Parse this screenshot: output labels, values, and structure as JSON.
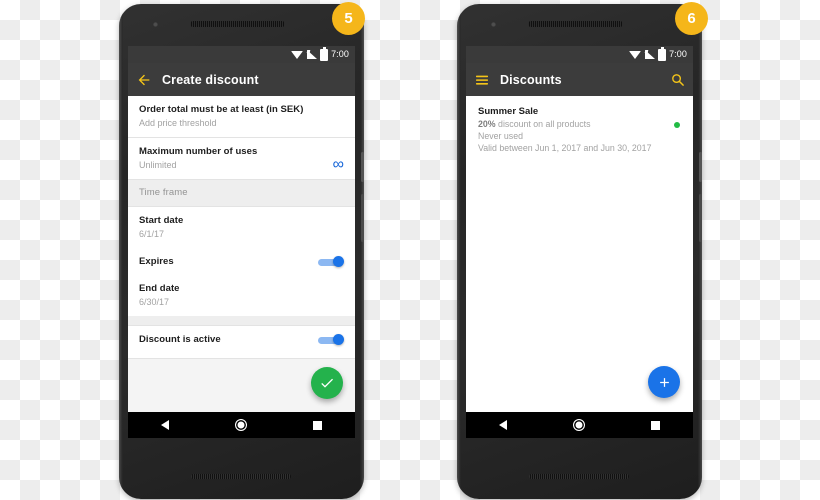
{
  "phones": [
    {
      "badge": "5",
      "status_bar": {
        "time": "7:00",
        "icons": [
          "wifi-icon",
          "signal-icon",
          "battery-icon"
        ]
      },
      "app_bar": {
        "nav_icon": "back-arrow-icon",
        "title": "Create discount"
      },
      "rows": [
        {
          "type": "item",
          "title": "Order total must be at least (in SEK)",
          "subtitle": "Add price threshold"
        },
        {
          "type": "item",
          "title": "Maximum number of uses",
          "subtitle": "Unlimited",
          "trailing": "infinity-icon",
          "trailing_glyph": "∞"
        },
        {
          "type": "section",
          "title": "Time frame"
        },
        {
          "type": "item",
          "title": "Start date",
          "subtitle": "6/1/17"
        },
        {
          "type": "toggle",
          "title": "Expires",
          "state": "on"
        },
        {
          "type": "item",
          "title": "End date",
          "subtitle": "6/30/17"
        },
        {
          "type": "gap"
        },
        {
          "type": "toggle",
          "title": "Discount is active",
          "state": "on"
        }
      ],
      "fab": {
        "icon": "check-icon",
        "color": "#24b24c"
      },
      "nav_bar": [
        "back-triangle-icon",
        "home-circle-icon",
        "recents-square-icon"
      ]
    },
    {
      "badge": "6",
      "status_bar": {
        "time": "7:00",
        "icons": [
          "wifi-icon",
          "signal-icon",
          "battery-icon"
        ]
      },
      "app_bar": {
        "nav_icon": "hamburger-menu-icon",
        "title": "Discounts",
        "action_icon": "search-icon"
      },
      "list": [
        {
          "title": "Summer Sale",
          "amount": "20%",
          "description": " discount on all products",
          "usage": "Never used",
          "validity": "Valid between Jun 1, 2017 and Jun 30, 2017",
          "status": "active-dot"
        }
      ],
      "fab": {
        "icon": "plus-icon",
        "color": "#1a73e8"
      },
      "nav_bar": [
        "back-triangle-icon",
        "home-circle-icon",
        "recents-square-icon"
      ]
    }
  ],
  "theme": {
    "app_bar_bg": "#3c3c3c",
    "status_bar_bg": "#3a3a3a",
    "accent_yellow": "#f5b61a",
    "accent_blue": "#1a73e8",
    "accent_green": "#24b24c",
    "badge_bg": "#f5b61a"
  }
}
